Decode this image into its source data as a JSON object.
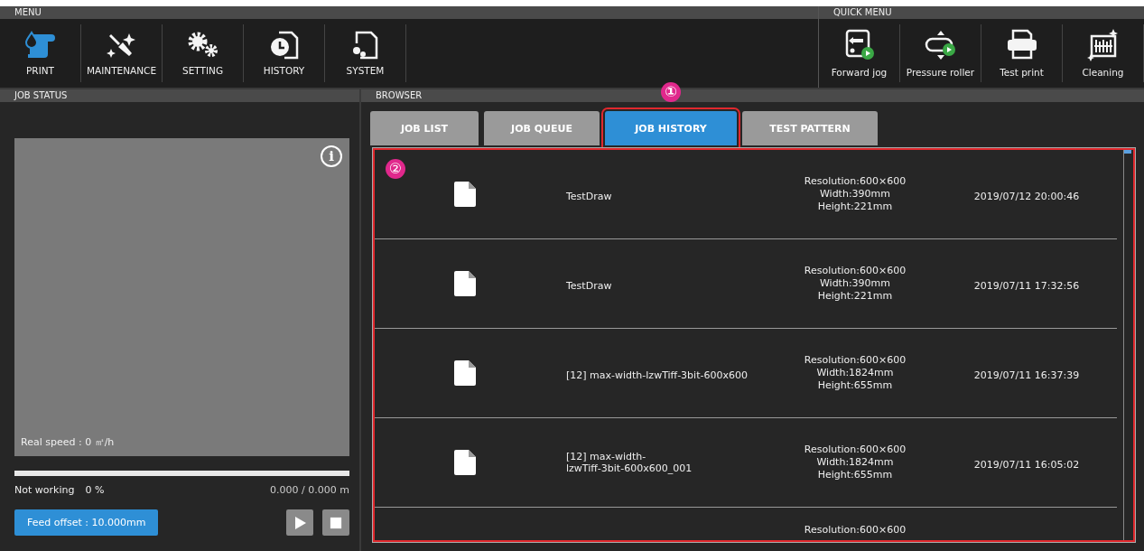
{
  "menu": {
    "title": "MENU",
    "items": [
      {
        "label": "PRINT",
        "selected": true
      },
      {
        "label": "MAINTENANCE",
        "selected": false
      },
      {
        "label": "SETTING",
        "selected": false
      },
      {
        "label": "HISTORY",
        "selected": false
      },
      {
        "label": "SYSTEM",
        "selected": false
      }
    ]
  },
  "quick_menu": {
    "title": "QUICK MENU",
    "items": [
      {
        "label": "Forward jog"
      },
      {
        "label": "Pressure roller"
      },
      {
        "label": "Test print"
      },
      {
        "label": "Cleaning"
      }
    ]
  },
  "job_status": {
    "title": "JOB STATUS",
    "info": "i",
    "real_speed": "Real speed : 0 ㎡/h",
    "progress": {
      "level": 0
    },
    "state": "Not working",
    "percent": "0 %",
    "length": "0.000 / 0.000 m",
    "feed_offset_button": "Feed offset : 10.000mm"
  },
  "browser": {
    "title": "BROWSER",
    "tabs": [
      {
        "label": "JOB LIST",
        "selected": false
      },
      {
        "label": "JOB QUEUE",
        "selected": false
      },
      {
        "label": "JOB HISTORY",
        "selected": true
      },
      {
        "label": "TEST PATTERN",
        "selected": false
      }
    ],
    "callouts": [
      "①",
      "②"
    ],
    "rows": [
      {
        "name": "TestDraw",
        "details": [
          "Resolution:600×600",
          "Width:390mm",
          "Height:221mm"
        ],
        "date": "2019/07/12 20:00:46"
      },
      {
        "name": "TestDraw",
        "details": [
          "Resolution:600×600",
          "Width:390mm",
          "Height:221mm"
        ],
        "date": "2019/07/11 17:32:56"
      },
      {
        "name": "[12] max-width-lzwTiff-3bit-600x600",
        "details": [
          "Resolution:600×600",
          "Width:1824mm",
          "Height:655mm"
        ],
        "date": "2019/07/11 16:37:39"
      },
      {
        "name": "[12] max-width-\nlzwTiff-3bit-600x600_001",
        "details": [
          "Resolution:600×600",
          "Width:1824mm",
          "Height:655mm"
        ],
        "date": "2019/07/11 16:05:02"
      },
      {
        "details": [
          "Resolution:600×600"
        ]
      }
    ]
  }
}
